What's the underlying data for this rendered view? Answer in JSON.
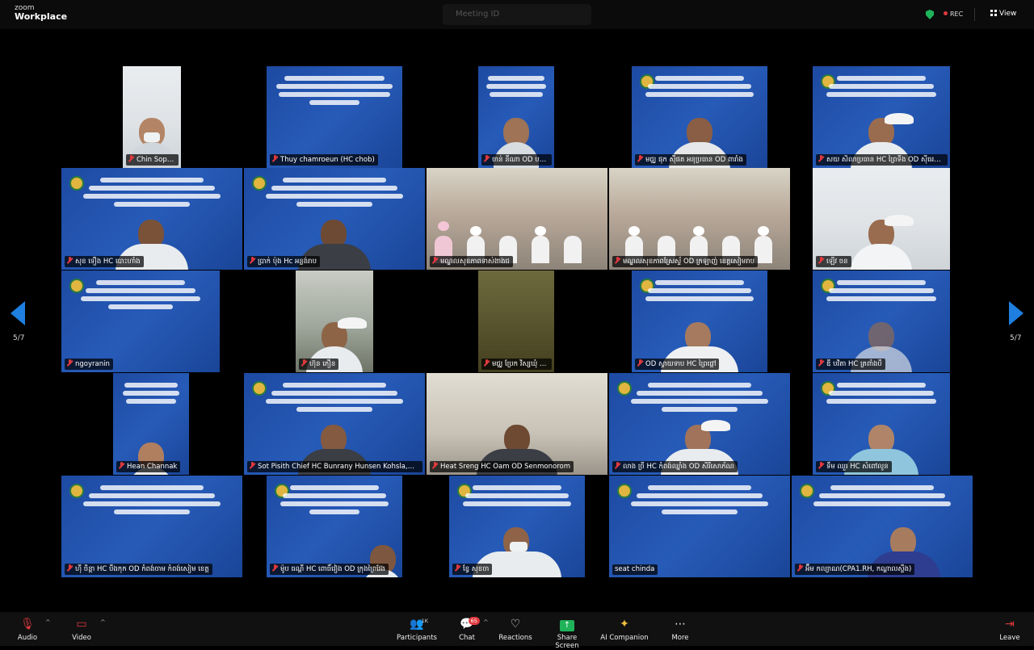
{
  "app": {
    "brand_small": "zoom",
    "brand_large": "Workplace",
    "meeting_title": "Meeting ID",
    "rec_label": "REC",
    "view_label": "View"
  },
  "colors": {
    "accent_blue": "#1e7fe0",
    "rec_red": "#e0393e",
    "secure_green": "#1fb35a",
    "banner_blue": "#2456b0"
  },
  "pagination": {
    "left": "5/7",
    "right": "5/7"
  },
  "banner_lines": [
    "ការបណ្តុះបណ្តាលពីកិច្ច",
    "ការងារផ្តល់សេវា",
    "ឆ្នាំ ២០២៥"
  ],
  "participants": [
    {
      "name": "Chin Sophally",
      "muted": true
    },
    {
      "name": "Thuy chamroeun (HC chob)",
      "muted": true
    },
    {
      "name": "ចាន់ នីណា OD បរាយណ៍ ស្ធុក HC កំពង់ធ្ម",
      "muted": true
    },
    {
      "name": "មជ្ឈ ផុក ស៊ីផត អនុប្រធាន OD ពារាំង",
      "muted": true
    },
    {
      "name": "សយ សិលាប្រធាន HC ព្រៃទីង OD ស៊ីធរកណ្ដាល",
      "muted": true
    },
    {
      "name": "សុខ ទឿង HC បោះហាំង",
      "muted": true
    },
    {
      "name": "ប្រាក់ ប៉ុង Hc អន្លង់រាប",
      "muted": true
    },
    {
      "name": "មណ្ឌលសុខភាពទាស់ងាងជ",
      "muted": true
    },
    {
      "name": "មណ្ឌលសុខភាពស្រែស្ទ័ OD ក្រឡាញ់ ខេត្តសៀមរាប",
      "muted": true
    },
    {
      "name": "ឡេីវ ចន",
      "muted": true
    },
    {
      "name": "ngoyranin",
      "muted": true
    },
    {
      "name": "ហ៊ុន ភឿន",
      "muted": true
    },
    {
      "name": "មជ្ឈ ប្រែក វិស្សឃុំ មន្ទីរពេទ្យបង្អែកមុខភៀង",
      "muted": true
    },
    {
      "name": "OD ស្វាយទាប HC ព្រៃផ្ដៅ",
      "muted": true
    },
    {
      "name": "ឌី បវិតា HC ត្រពាំងបី",
      "muted": true
    },
    {
      "name": "Hean Channak",
      "muted": true
    },
    {
      "name": "Sot Pisith Chief HC Bunrany Hunsen Kohsla,OD Chhuk",
      "muted": true
    },
    {
      "name": "Heat Sreng HC Oam OD Senmonorom",
      "muted": true
    },
    {
      "name": "លាង ច្រី HC កំពង់ឈ្នាំង OD សិរីសោភ័ណ",
      "muted": true
    },
    {
      "name": "ទឹម ឈួរ HC សំពៅលូន",
      "muted": true
    },
    {
      "name": "ហ៊ី ចិន្តា HC បឹងកុក OD កំពង់ចាម កំពង់សៀម ខេត្ត",
      "muted": true
    },
    {
      "name": "ម៉ូប ធណ្ដី HC ពោធិ៍វៀង OD ក្រុងព្រៃវែង",
      "muted": true
    },
    {
      "name": "ខែ្វ សុខចា",
      "muted": true
    },
    {
      "name": "seat chinda",
      "muted": true
    },
    {
      "name": "អ៊ឹម កល្យាណ(CPA1.RH, កណ្តាលស្ទឹង)",
      "muted": true
    }
  ],
  "toolbar": {
    "audio": "Audio",
    "video": "Video",
    "participants": "Participants",
    "participants_count": "1K",
    "chat": "Chat",
    "chat_badge": "65",
    "reactions": "Reactions",
    "share": "Share Screen",
    "ai": "AI Companion",
    "more": "More",
    "leave": "Leave"
  }
}
